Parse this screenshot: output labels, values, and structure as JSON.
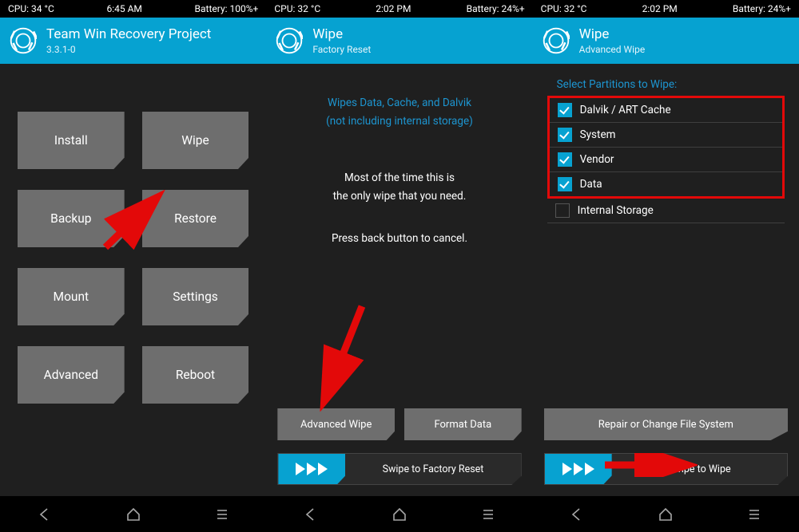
{
  "screens": [
    {
      "status": {
        "cpu": "CPU: 34 °C",
        "time": "6:45 AM",
        "battery": "Battery: 100%+"
      },
      "header": {
        "title": "Team Win Recovery Project",
        "subtitle": "3.3.1-0"
      },
      "tiles": [
        "Install",
        "Wipe",
        "Backup",
        "Restore",
        "Mount",
        "Settings",
        "Advanced",
        "Reboot"
      ]
    },
    {
      "status": {
        "cpu": "CPU: 32 °C",
        "time": "2:02 PM",
        "battery": "Battery: 24%+"
      },
      "header": {
        "title": "Wipe",
        "subtitle": "Factory Reset"
      },
      "blue_line1": "Wipes Data, Cache, and Dalvik",
      "blue_line2": "(not including internal storage)",
      "white_line1": "Most of the time this is",
      "white_line2": "the only wipe that you need.",
      "cancel_line": "Press back button to cancel.",
      "btn1": "Advanced Wipe",
      "btn2": "Format Data",
      "swipe": "Swipe to Factory Reset"
    },
    {
      "status": {
        "cpu": "CPU: 32 °C",
        "time": "2:02 PM",
        "battery": "Battery: 24%+"
      },
      "header": {
        "title": "Wipe",
        "subtitle": "Advanced Wipe"
      },
      "section_title": "Select Partitions to Wipe:",
      "parts": [
        {
          "label": "Dalvik / ART Cache",
          "checked": true
        },
        {
          "label": "System",
          "checked": true
        },
        {
          "label": "Vendor",
          "checked": true
        },
        {
          "label": "Data",
          "checked": true
        }
      ],
      "extra_part": {
        "label": "Internal Storage",
        "checked": false
      },
      "repair_btn": "Repair or Change File System",
      "swipe": "Swipe to Wipe"
    }
  ]
}
